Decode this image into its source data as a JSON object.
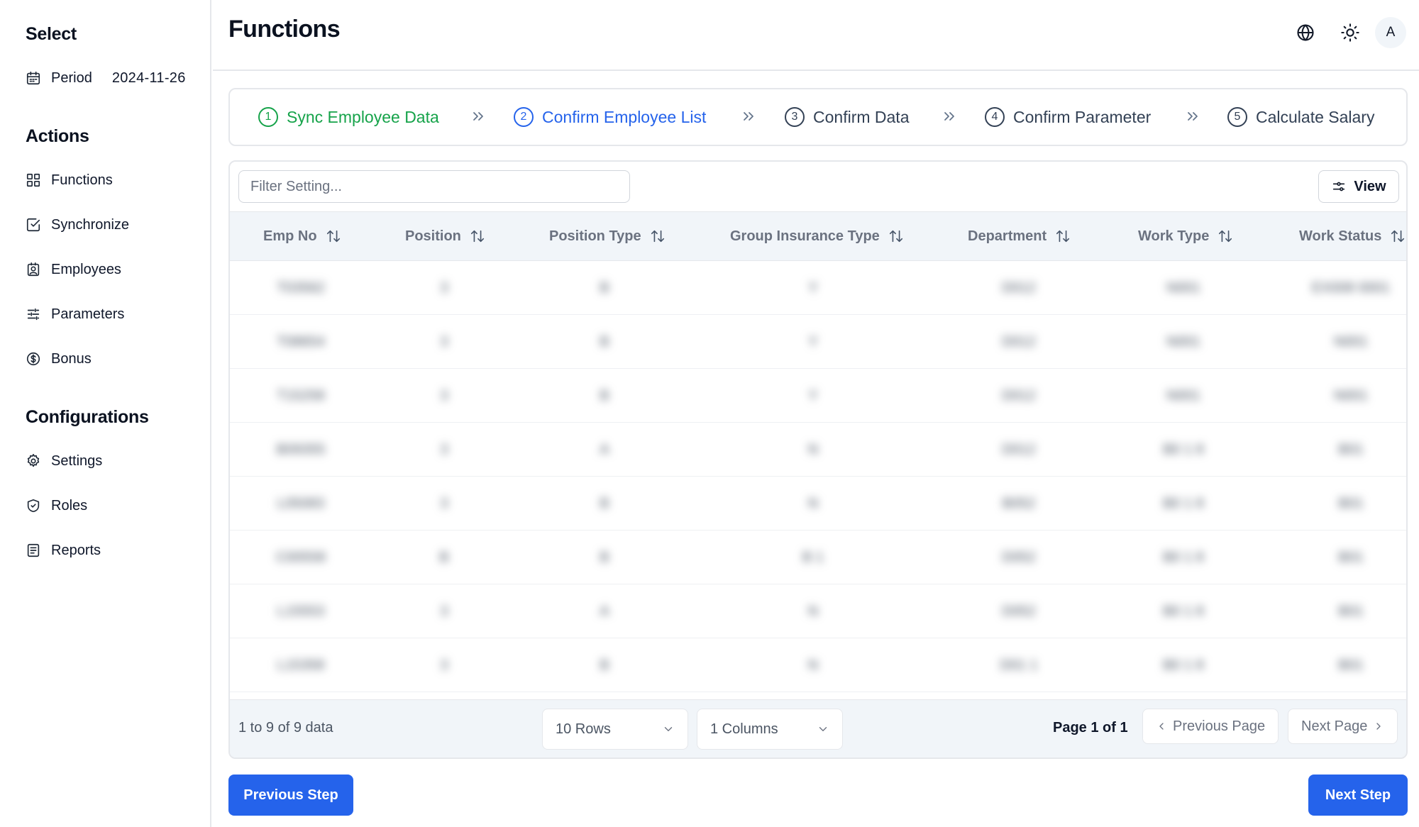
{
  "sidebar": {
    "select_title": "Select",
    "period_label": "Period",
    "period_value": "2024-11-26",
    "actions_title": "Actions",
    "actions": [
      "Functions",
      "Synchronize",
      "Employees",
      "Parameters",
      "Bonus"
    ],
    "config_title": "Configurations",
    "configurations": [
      "Settings",
      "Roles",
      "Reports"
    ]
  },
  "header": {
    "title": "Functions",
    "avatar_initial": "A",
    "icons": [
      "globe-icon",
      "sun-icon"
    ]
  },
  "stepper": {
    "steps": [
      {
        "num": "1",
        "label": "Sync Employee Data",
        "state": "done"
      },
      {
        "num": "2",
        "label": "Confirm Employee List",
        "state": "active"
      },
      {
        "num": "3",
        "label": "Confirm Data",
        "state": "todo"
      },
      {
        "num": "4",
        "label": "Confirm Parameter",
        "state": "todo"
      },
      {
        "num": "5",
        "label": "Calculate Salary",
        "state": "todo"
      }
    ]
  },
  "table": {
    "filter_placeholder": "Filter Setting...",
    "view_label": "View",
    "columns": [
      "Emp No",
      "Position",
      "Position Type",
      "Group Insurance Type",
      "Department",
      "Work Type",
      "Work Status"
    ],
    "rows": [
      [
        "T03562",
        "3",
        "B",
        "Y",
        "D012",
        "N001",
        "EX008 0001"
      ],
      [
        "T08654",
        "3",
        "B",
        "Y",
        "D012",
        "N001",
        "N001"
      ],
      [
        "T15258",
        "3",
        "B",
        "Y",
        "D012",
        "N001",
        "N001"
      ],
      [
        "B09355",
        "3",
        "A",
        "N",
        "D012",
        "B0 1 8",
        "B01"
      ],
      [
        "L05083",
        "3",
        "B",
        "N",
        "B052",
        "B0 1 8",
        "B01"
      ],
      [
        "C00558",
        "B",
        "B",
        "B 1",
        "D052",
        "B0 1 8",
        "B01"
      ],
      [
        "L15553",
        "3",
        "A",
        "N",
        "D052",
        "B0 1 8",
        "B01"
      ],
      [
        "L15358",
        "3",
        "B",
        "N",
        "D01 1",
        "B0 1 8",
        "B01"
      ]
    ],
    "footer": {
      "count_text": "1 to 9 of 9 data",
      "rows_select": "10 Rows",
      "columns_select": "1 Columns",
      "page_text": "Page 1 of 1",
      "prev_page": "Previous Page",
      "next_page": "Next Page"
    }
  },
  "actions": {
    "previous_step": "Previous Step",
    "next_step": "Next Step"
  },
  "colors": {
    "done": "#16a34a",
    "active": "#2563eb",
    "primary": "#2563eb"
  }
}
